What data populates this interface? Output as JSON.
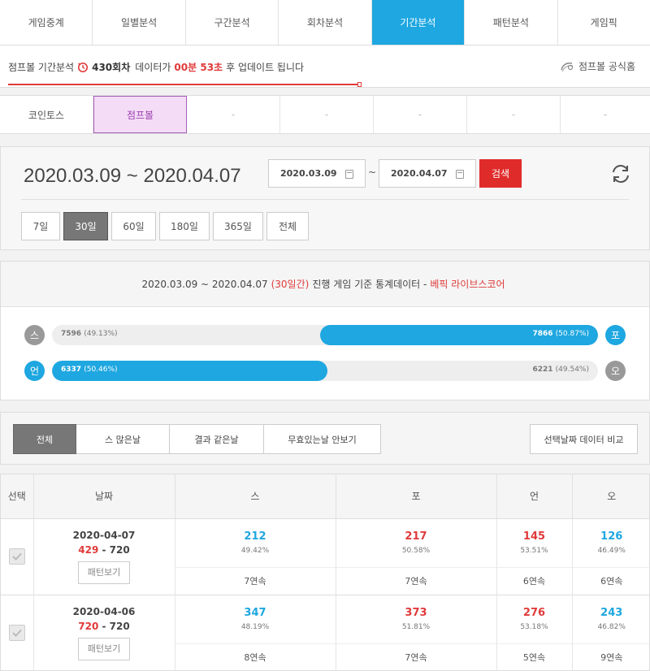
{
  "nav": {
    "tabs": [
      "게임중계",
      "일별분석",
      "구간분석",
      "회차분석",
      "기간분석",
      "패턴분석",
      "게임픽"
    ],
    "active_index": 4
  },
  "info": {
    "prefix": "점프볼 기간분석",
    "round": "430회차",
    "middle": "데이터가",
    "countdown": "00분 53초",
    "suffix": "후 업데이트 됩니다",
    "home_link": "점프볼 공식홈"
  },
  "games": {
    "tabs": [
      "코인토스",
      "점프볼",
      "-",
      "-",
      "-",
      "-",
      "-"
    ],
    "active_index": 1
  },
  "dates": {
    "range": "2020.03.09 ~ 2020.04.07",
    "start": "2020.03.09",
    "end": "2020.04.07",
    "tilde": "~",
    "search": "검색",
    "periods": [
      "7일",
      "30일",
      "60일",
      "180일",
      "365일",
      "전체"
    ],
    "active_period": 1
  },
  "stats": {
    "range": "2020.03.09 ~ 2020.04.07",
    "days": "(30일간)",
    "middle": "진행 게임 기준 통계데이터 -",
    "source": "베픽 라이브스코어",
    "row1": {
      "left_icon": "스",
      "right_icon": "포",
      "left_count": "7596",
      "left_pct": "(49.13%)",
      "right_count": "7866",
      "right_pct": "(50.87%)",
      "fill_fraction": 0.5087
    },
    "row2": {
      "left_icon": "언",
      "right_icon": "오",
      "left_count": "6337",
      "left_pct": "(50.46%)",
      "right_count": "6221",
      "right_pct": "(49.54%)",
      "fill_fraction": 0.5046
    }
  },
  "filters": {
    "buttons": [
      "전체",
      "스 많은날",
      "결과 같은날",
      "무효있는날 안보기"
    ],
    "active_index": 0,
    "compare": "선택날짜 데이터 비교"
  },
  "table": {
    "headers": [
      "선택",
      "날짜",
      "스",
      "포",
      "언",
      "오"
    ],
    "pattern_btn": "패턴보기",
    "rows": [
      {
        "date": "2020-04-07",
        "played": "429",
        "sep": " - ",
        "total": "720",
        "s": "212",
        "s_pct": "49.42%",
        "p": "217",
        "p_pct": "50.58%",
        "u": "145",
        "u_pct": "53.51%",
        "o": "126",
        "o_pct": "46.49%",
        "s_streak": "7연속",
        "p_streak": "7연속",
        "u_streak": "6연속",
        "o_streak": "6연속"
      },
      {
        "date": "2020-04-06",
        "played": "720",
        "sep": " - ",
        "total": "720",
        "s": "347",
        "s_pct": "48.19%",
        "p": "373",
        "p_pct": "51.81%",
        "u": "276",
        "u_pct": "53.18%",
        "o": "243",
        "o_pct": "46.82%",
        "s_streak": "8연속",
        "p_streak": "7연속",
        "u_streak": "5연속",
        "o_streak": "9연속"
      }
    ]
  }
}
